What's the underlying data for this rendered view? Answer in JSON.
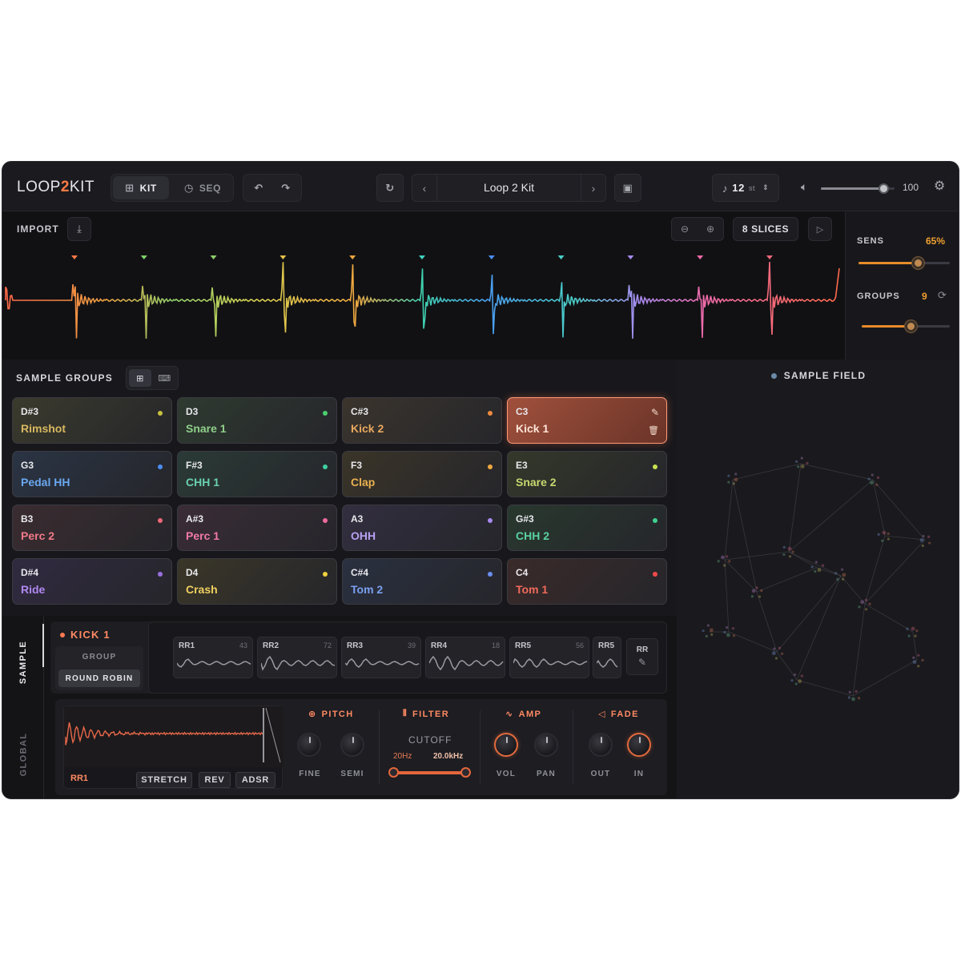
{
  "app": {
    "logo_left": "LOOP",
    "logo_accent": "2",
    "logo_right": "KIT"
  },
  "toolbar": {
    "kit_label": "KIT",
    "seq_label": "SEQ",
    "preset_name": "Loop 2 Kit",
    "transpose_value": "12",
    "transpose_unit": "st",
    "volume_value": "100",
    "volume_level": 0.85
  },
  "waveform": {
    "import_label": "IMPORT",
    "slices_label": "8 SLICES",
    "marker_colors": [
      "#ff7a45",
      "#7fd66a",
      "#8fd06a",
      "#e8c24a",
      "#f0a840",
      "#3fd2c0",
      "#4a8ef0",
      "#4ad0c8",
      "#a88af0",
      "#f06aa8",
      "#f0687a"
    ]
  },
  "side": {
    "sens_label": "SENS",
    "sens_value": "65%",
    "sens_level": 0.65,
    "groups_label": "GROUPS",
    "groups_value": "9",
    "groups_level": 0.55
  },
  "groups": {
    "title": "SAMPLE GROUPS",
    "pads": [
      {
        "note": "D#3",
        "name": "Rimshot",
        "color": "#d8b860",
        "dot": "#c8c040",
        "bg": "#3a3a2c"
      },
      {
        "note": "D3",
        "name": "Snare 1",
        "color": "#8fd08a",
        "dot": "#4ad070",
        "bg": "#2e3a30"
      },
      {
        "note": "C#3",
        "name": "Kick 2",
        "color": "#e8a860",
        "dot": "#f08a40",
        "bg": "#3a342c"
      },
      {
        "note": "C3",
        "name": "Kick 1",
        "color": "#ffe2d6",
        "dot": "",
        "bg": "#8a4a38",
        "selected": true
      },
      {
        "note": "G3",
        "name": "Pedal HH",
        "color": "#6aa8f0",
        "dot": "#4a8ef0",
        "bg": "#2a3444"
      },
      {
        "note": "F#3",
        "name": "CHH 1",
        "color": "#6ad0b0",
        "dot": "#3fd0a0",
        "bg": "#2a3a36"
      },
      {
        "note": "F3",
        "name": "Clap",
        "color": "#e8b050",
        "dot": "#f0a840",
        "bg": "#3a3428"
      },
      {
        "note": "E3",
        "name": "Snare 2",
        "color": "#c8d870",
        "dot": "#c8e050",
        "bg": "#34382a"
      },
      {
        "note": "B3",
        "name": "Perc 2",
        "color": "#f07a8a",
        "dot": "#f0687a",
        "bg": "#3a2c30"
      },
      {
        "note": "A#3",
        "name": "Perc 1",
        "color": "#f07aa8",
        "dot": "#f06aa0",
        "bg": "#3a2c36"
      },
      {
        "note": "A3",
        "name": "OHH",
        "color": "#b8a0f0",
        "dot": "#a88af0",
        "bg": "#322e40"
      },
      {
        "note": "G#3",
        "name": "CHH 2",
        "color": "#5ad0a0",
        "dot": "#3fd090",
        "bg": "#28382e"
      },
      {
        "note": "D#4",
        "name": "Ride",
        "color": "#b088f0",
        "dot": "#9a70e0",
        "bg": "#302a40"
      },
      {
        "note": "D4",
        "name": "Crash",
        "color": "#f0d060",
        "dot": "#f0d040",
        "bg": "#3a3628"
      },
      {
        "note": "C#4",
        "name": "Tom 2",
        "color": "#7aa0f0",
        "dot": "#6a8ef0",
        "bg": "#2a3040"
      },
      {
        "note": "C4",
        "name": "Tom 1",
        "color": "#f06a5a",
        "dot": "#f04a4a",
        "bg": "#3a2a2a"
      }
    ]
  },
  "field": {
    "title": "SAMPLE FIELD"
  },
  "tabs": {
    "sample": "SAMPLE",
    "global": "GLOBAL"
  },
  "sample": {
    "name": "KICK 1",
    "group_label": "GROUP",
    "mode": "ROUND ROBIN",
    "rr": [
      {
        "label": "RR1",
        "value": "43"
      },
      {
        "label": "RR2",
        "value": "72"
      },
      {
        "label": "RR3",
        "value": "39"
      },
      {
        "label": "RR4",
        "value": "18"
      },
      {
        "label": "RR5",
        "value": "56"
      },
      {
        "label": "RR5",
        "value": ""
      }
    ],
    "rr_add_label": "RR",
    "clip_label": "RR1",
    "stretch": "STRETCH",
    "rev": "REV",
    "adsr": "ADSR"
  },
  "controls": {
    "pitch": "PITCH",
    "fine": "FINE",
    "semi": "SEMI",
    "filter": "FILTER",
    "cutoff": "CUTOFF",
    "low_freq": "20Hz",
    "high_freq": "20.0kHz",
    "amp": "AMP",
    "vol": "VOL",
    "pan": "PAN",
    "fade": "FADE",
    "out": "OUT",
    "in": "IN"
  }
}
